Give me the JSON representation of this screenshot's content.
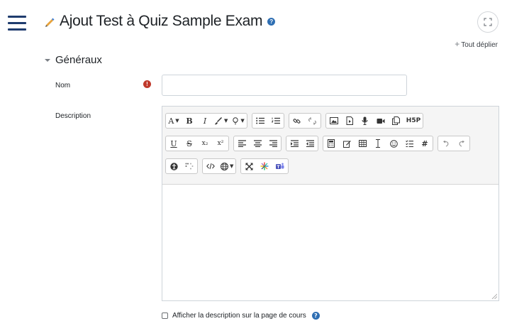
{
  "header": {
    "title": "Ajout Test à Quiz Sample Exam",
    "help_glyph": "?",
    "title_icon": "quiz-icon"
  },
  "actions": {
    "expand_all_label": "Tout déplier",
    "expand_all_glyph": "+"
  },
  "section": {
    "title": "Généraux",
    "expanded": true
  },
  "fields": {
    "name": {
      "label": "Nom",
      "value": "",
      "required": true,
      "required_glyph": "!"
    },
    "description": {
      "label": "Description",
      "value": ""
    }
  },
  "toolbar": {
    "font_glyph": "A",
    "bold_glyph": "B",
    "italic_glyph": "I",
    "underline_glyph": "U",
    "strike_glyph": "S",
    "subscript_glyph": "x₂",
    "superscript_glyph": "x²",
    "h5p_label": "H5P",
    "special_char_glyph": "#"
  },
  "options": {
    "show_description_label": "Afficher la description sur la page de cours",
    "show_description_checked": false,
    "help_glyph": "?"
  },
  "colors": {
    "accent": "#1f3c6e",
    "required": "#c0392b",
    "help": "#2f6fb3",
    "toolbar_bg": "#f5f5f5"
  }
}
